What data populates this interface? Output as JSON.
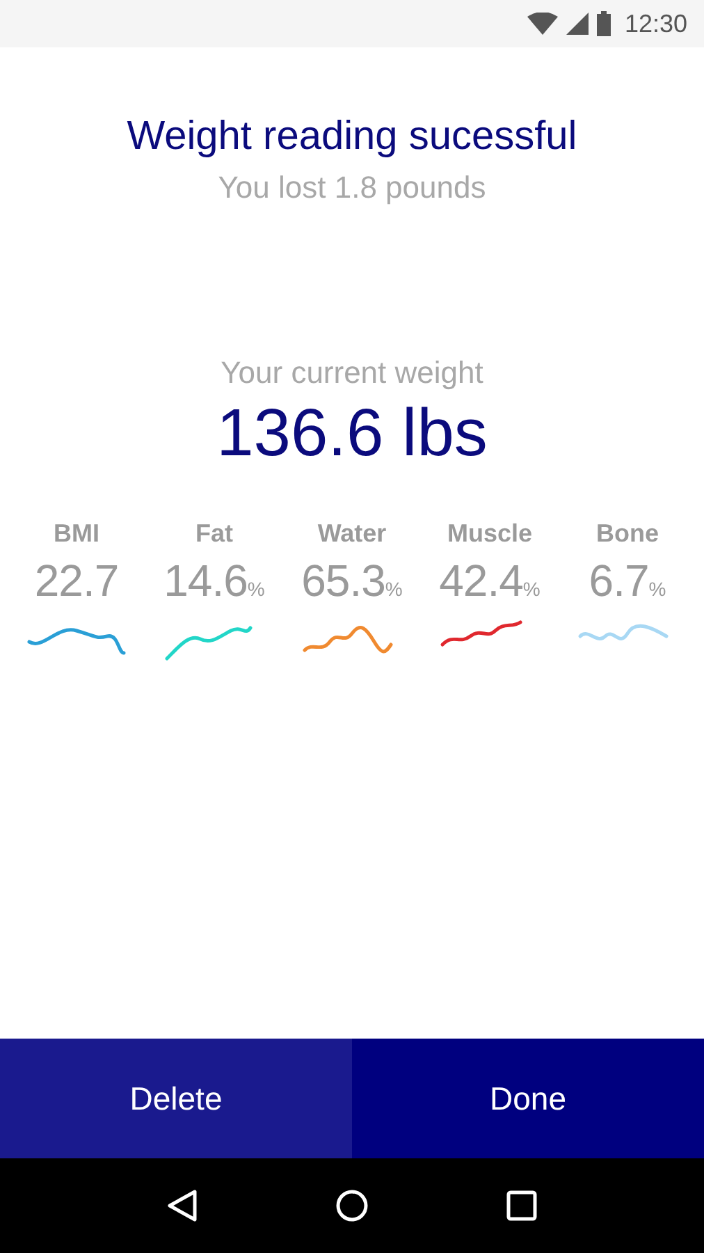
{
  "status_bar": {
    "time": "12:30"
  },
  "header": {
    "title": "Weight reading sucessful",
    "subtitle": "You lost 1.8 pounds"
  },
  "current": {
    "label": "Your current weight",
    "value": "136.6 lbs"
  },
  "metrics": [
    {
      "label": "BMI",
      "value": "22.7",
      "color": "#2a9fd6"
    },
    {
      "label": "Fat",
      "value": "14.6",
      "unit": "%",
      "color": "#22d6c8"
    },
    {
      "label": "Water",
      "value": "65.3",
      "unit": "%",
      "color": "#f08a30"
    },
    {
      "label": "Muscle",
      "value": "42.4",
      "unit": "%",
      "color": "#e0282e"
    },
    {
      "label": "Bone",
      "value": "6.7",
      "unit": "%",
      "color": "#a8d8f4"
    }
  ],
  "buttons": [
    {
      "label": "Delete",
      "kind": "secondary"
    },
    {
      "label": "Done",
      "kind": "primary"
    }
  ]
}
